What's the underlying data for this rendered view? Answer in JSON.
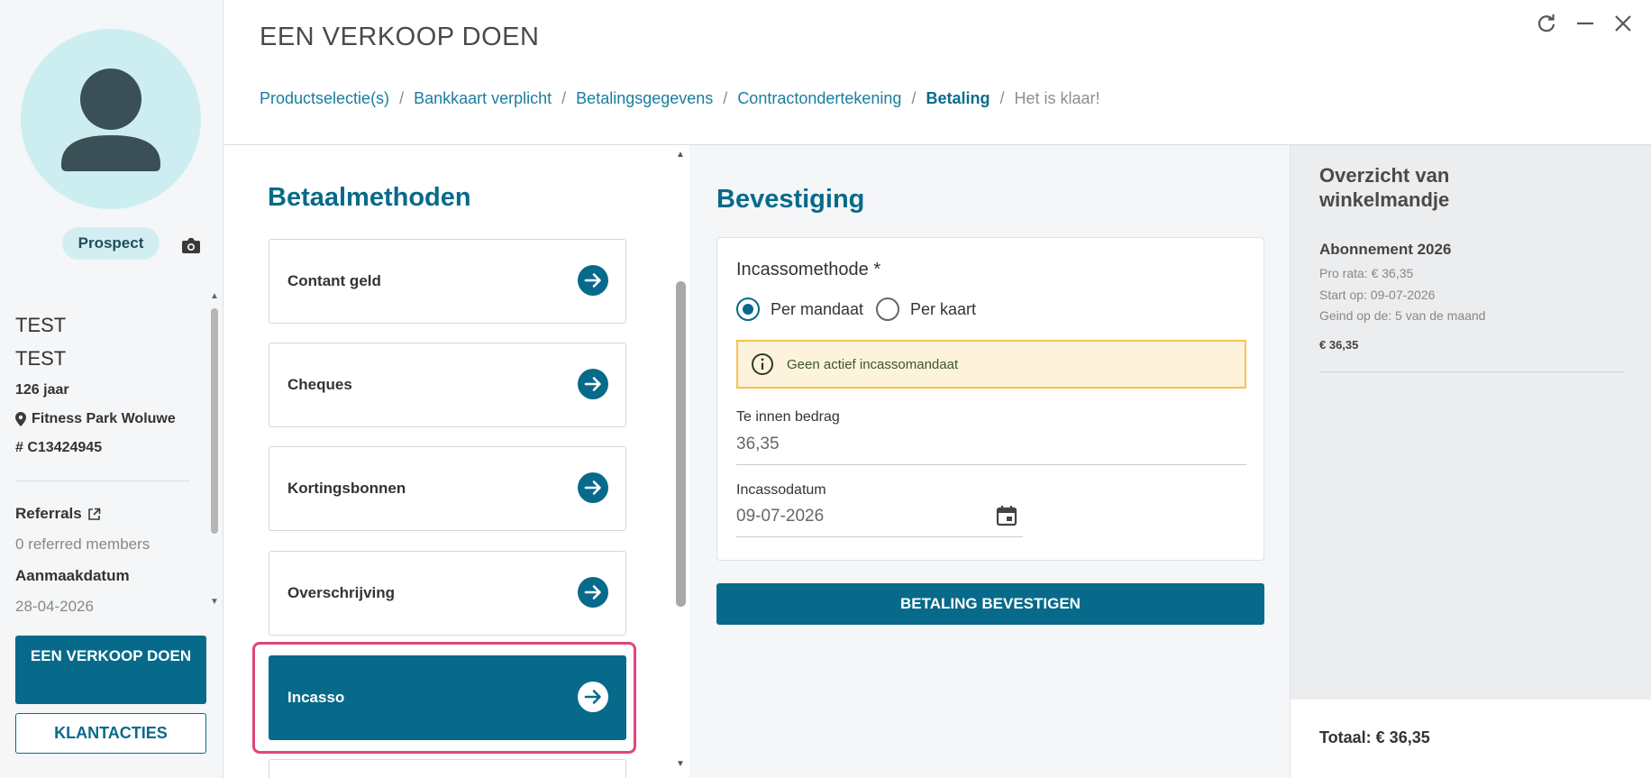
{
  "window": {
    "title": "EEN VERKOOP DOEN",
    "refresh_icon": "refresh-icon",
    "minimize_icon": "minimize-icon",
    "close_icon": "close-icon"
  },
  "breadcrumb": {
    "items": [
      {
        "label": "Productselectie(s)",
        "state": "link"
      },
      {
        "label": "Bankkaart verplicht",
        "state": "link"
      },
      {
        "label": "Betalingsgegevens",
        "state": "link"
      },
      {
        "label": "Contractondertekening",
        "state": "link"
      },
      {
        "label": "Betaling",
        "state": "active"
      },
      {
        "label": "Het is klaar!",
        "state": "disabled"
      }
    ],
    "separator": "/"
  },
  "sidebar": {
    "status_badge": "Prospect",
    "first_name": "TEST",
    "last_name": "TEST",
    "age": "126 jaar",
    "location": "Fitness Park Woluwe",
    "member_id": "# C13424945",
    "referrals_label": "Referrals",
    "referrals_value": "0 referred members",
    "created_label": "Aanmaakdatum",
    "created_value": "28-04-2026",
    "sale_button": "EEN VERKOOP DOEN",
    "actions_button": "KLANTACTIES"
  },
  "methods": {
    "title": "Betaalmethoden",
    "items": [
      {
        "label": "Contant geld",
        "selected": false
      },
      {
        "label": "Cheques",
        "selected": false
      },
      {
        "label": "Kortingsbonnen",
        "selected": false
      },
      {
        "label": "Overschrijving",
        "selected": false
      },
      {
        "label": "Incasso",
        "selected": true
      }
    ]
  },
  "confirmation": {
    "title": "Bevestiging",
    "method_label": "Incassomethode *",
    "options": [
      {
        "label": "Per mandaat",
        "checked": true
      },
      {
        "label": "Per kaart",
        "checked": false
      }
    ],
    "warning": "Geen actief incassomandaat",
    "amount_label": "Te innen bedrag",
    "amount_value": "36,35",
    "date_label": "Incassodatum",
    "date_value": "09-07-2026",
    "confirm_button": "BETALING BEVESTIGEN"
  },
  "cart": {
    "title": "Overzicht van winkelmandje",
    "item_title": "Abonnement 2026",
    "pro_rata": "Pro rata: € 36,35",
    "start": "Start op: 09-07-2026",
    "collected": "Geind op de: 5 van de maand",
    "price": "€ 36,35",
    "total": "Totaal: € 36,35"
  },
  "colors": {
    "primary": "#076a8a",
    "highlight": "#e0457b",
    "warning_bg": "#fdf3dc",
    "warning_border": "#f6c34a"
  }
}
